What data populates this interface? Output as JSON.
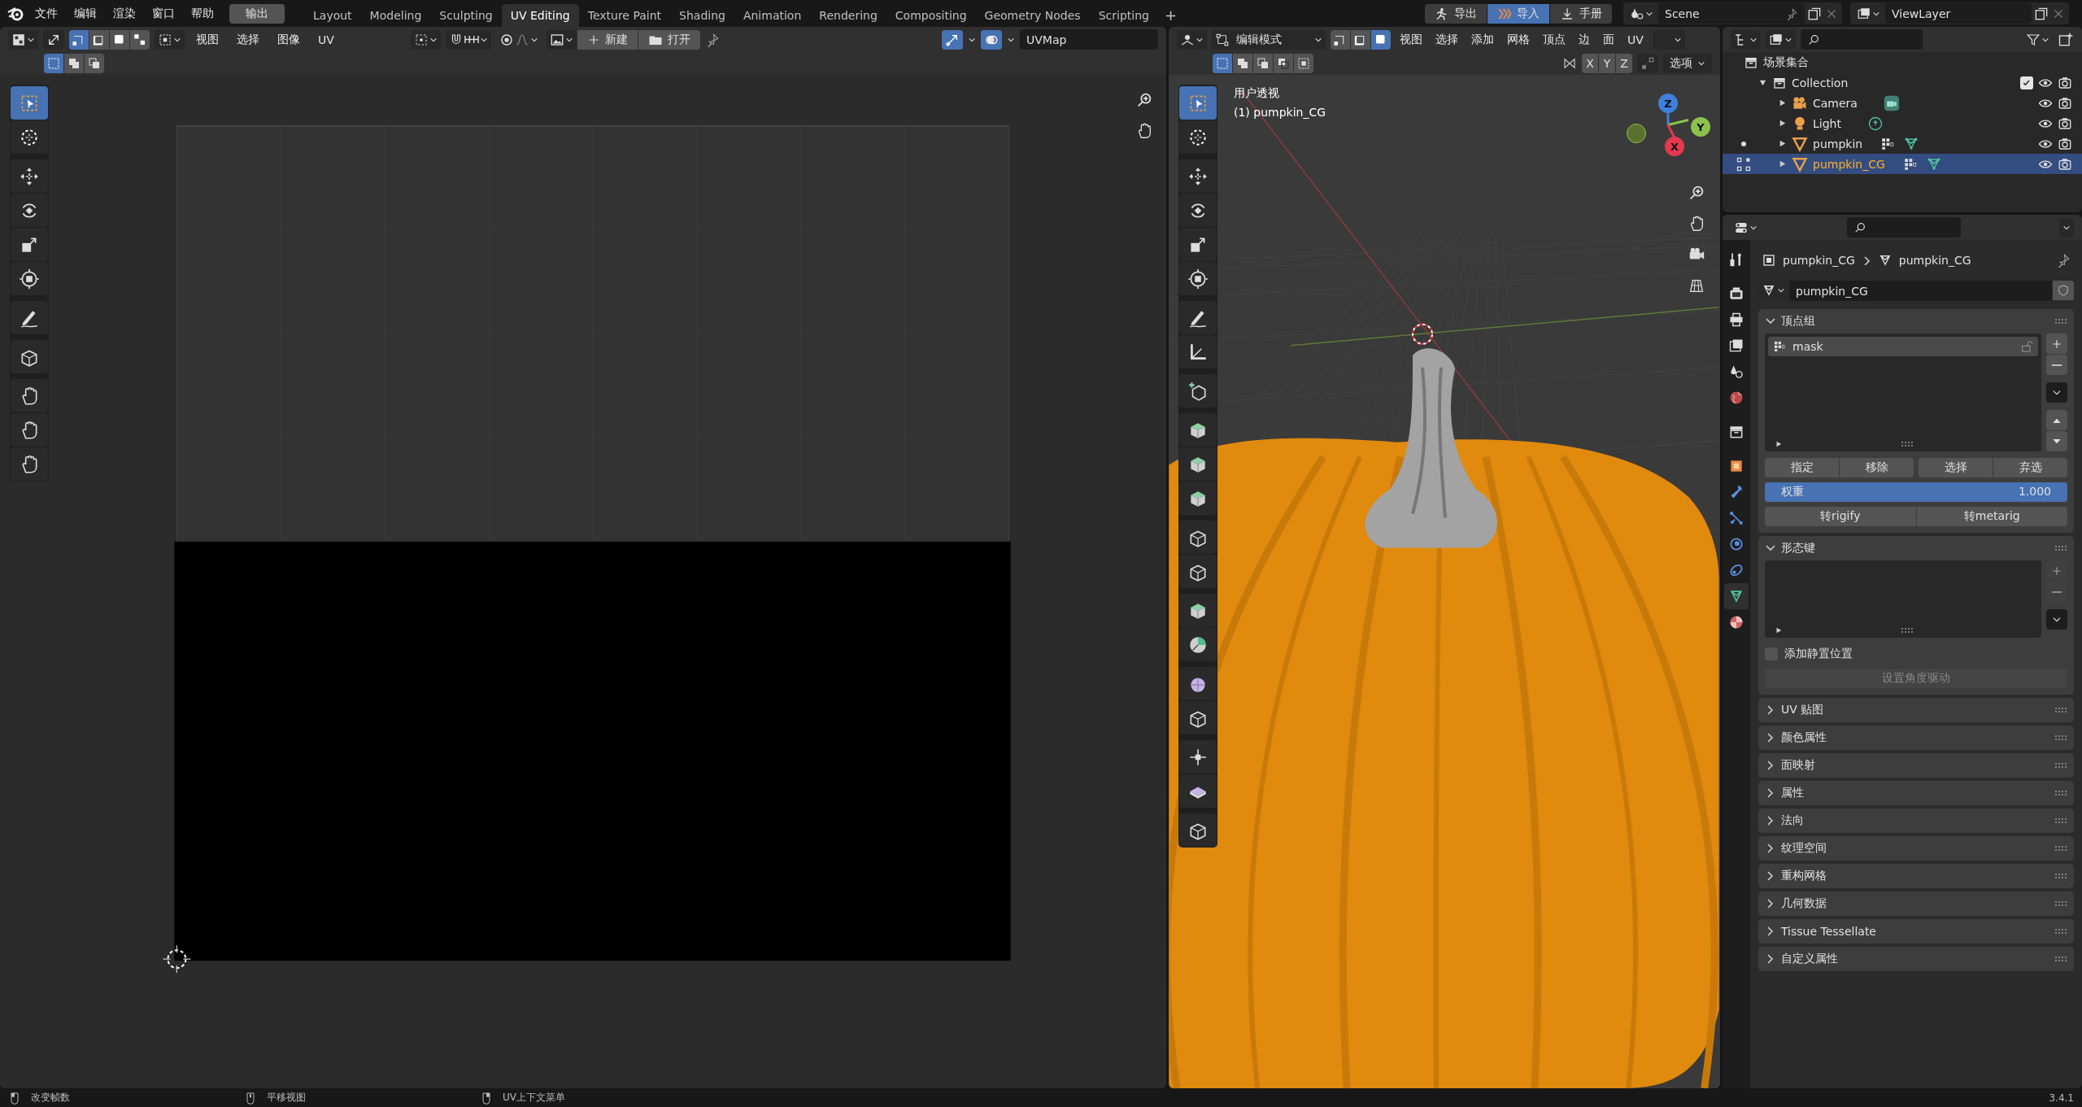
{
  "topbar": {
    "menus": [
      "文件",
      "编辑",
      "渲染",
      "窗口",
      "帮助"
    ],
    "output_button": "输出",
    "workspaces": [
      {
        "label": "Layout",
        "selected": false
      },
      {
        "label": "Modeling",
        "selected": false
      },
      {
        "label": "Sculpting",
        "selected": false
      },
      {
        "label": "UV Editing",
        "selected": true
      },
      {
        "label": "Texture Paint",
        "selected": false
      },
      {
        "label": "Shading",
        "selected": false
      },
      {
        "label": "Animation",
        "selected": false
      },
      {
        "label": "Rendering",
        "selected": false
      },
      {
        "label": "Compositing",
        "selected": false
      },
      {
        "label": "Geometry Nodes",
        "selected": false
      },
      {
        "label": "Scripting",
        "selected": false
      }
    ],
    "add_workspace": "+",
    "addon_buttons": [
      {
        "kind": "export",
        "label": "导出",
        "selected": false
      },
      {
        "kind": "import",
        "label": "导入",
        "selected": true
      },
      {
        "kind": "manual",
        "label": "手册",
        "selected": false
      }
    ],
    "scene": "Scene",
    "view_layer": "ViewLayer"
  },
  "uv_editor": {
    "select_modes": [
      {
        "kind": "vertex",
        "selected": true
      },
      {
        "kind": "edge",
        "selected": false
      },
      {
        "kind": "face",
        "selected": false
      },
      {
        "kind": "island",
        "selected": false
      }
    ],
    "menus": [
      "视图",
      "选择",
      "图像",
      "UV"
    ],
    "new_button": "新建",
    "open_button": "打开",
    "uv_map": "UVMap",
    "box_modes": [
      {
        "selected": true
      },
      {
        "selected": false
      },
      {
        "selected": false
      }
    ],
    "tools": [
      {
        "kind": "select",
        "selected": true
      },
      {
        "kind": "cursor",
        "selected": false
      },
      {
        "kind": "move",
        "selected": false
      },
      {
        "kind": "rotate",
        "selected": false
      },
      {
        "kind": "scale",
        "selected": false
      },
      {
        "kind": "transform",
        "selected": false
      },
      {
        "kind": "annotate",
        "selected": false
      },
      {
        "kind": "rip",
        "selected": false
      },
      {
        "kind": "grab",
        "selected": false
      },
      {
        "kind": "relax",
        "selected": false
      },
      {
        "kind": "pinch",
        "selected": false
      }
    ]
  },
  "viewport": {
    "mode": "编辑模式",
    "select_modes": [
      {
        "kind": "vertex",
        "selected": false
      },
      {
        "kind": "edge",
        "selected": false
      },
      {
        "kind": "face",
        "selected": true
      }
    ],
    "menus": [
      "视图",
      "选择",
      "添加",
      "网格",
      "顶点",
      "边",
      "面",
      "UV"
    ],
    "box_modes": [
      {
        "selected": true
      },
      {
        "selected": false
      },
      {
        "selected": false
      },
      {
        "selected": false
      },
      {
        "selected": false
      }
    ],
    "mirror_axes": [
      {
        "label": "X",
        "selected": false
      },
      {
        "label": "Y",
        "selected": false
      },
      {
        "label": "Z",
        "selected": false
      }
    ],
    "options": "选项",
    "view_name": "用户透视",
    "object_label": "(1) pumpkin_CG",
    "gizmo_axes": [
      "Z",
      "Y",
      "X"
    ],
    "tools": [
      {
        "kind": "select",
        "selected": true
      },
      {
        "kind": "cursor",
        "selected": false
      },
      {
        "kind": "move",
        "selected": false
      },
      {
        "kind": "rotate",
        "selected": false
      },
      {
        "kind": "scale",
        "selected": false
      },
      {
        "kind": "transform",
        "selected": false
      },
      {
        "kind": "annotate",
        "selected": false
      },
      {
        "kind": "measure",
        "selected": false
      },
      {
        "kind": "add_cube",
        "selected": false
      },
      {
        "kind": "extrude",
        "selected": false
      },
      {
        "kind": "inset",
        "selected": false
      },
      {
        "kind": "bevel",
        "selected": false
      },
      {
        "kind": "loop_cut",
        "selected": false
      },
      {
        "kind": "knife",
        "selected": false
      },
      {
        "kind": "poly_build",
        "selected": false
      },
      {
        "kind": "spin",
        "selected": false
      },
      {
        "kind": "smooth",
        "selected": false
      },
      {
        "kind": "edge_slide",
        "selected": false
      },
      {
        "kind": "shrink",
        "selected": false
      },
      {
        "kind": "shear",
        "selected": false
      },
      {
        "kind": "rip",
        "selected": false
      }
    ]
  },
  "outliner": {
    "root": "场景集合",
    "collections": [
      {
        "name": "Collection",
        "expanded": true,
        "checked": true,
        "children": [
          {
            "name": "Camera",
            "kind": "camera",
            "selected": false
          },
          {
            "name": "Light",
            "kind": "light",
            "selected": false
          },
          {
            "name": "pumpkin",
            "kind": "mesh",
            "selected": false,
            "edit_mode": false
          },
          {
            "name": "pumpkin_CG",
            "kind": "mesh",
            "selected": true,
            "edit_mode": true
          }
        ]
      }
    ]
  },
  "properties": {
    "tabs": [
      {
        "kind": "tool",
        "selected": false
      },
      {
        "kind": "render",
        "selected": false
      },
      {
        "kind": "output",
        "selected": false
      },
      {
        "kind": "view_layer",
        "selected": false
      },
      {
        "kind": "scene",
        "selected": false
      },
      {
        "kind": "world",
        "selected": false
      },
      {
        "kind": "collection",
        "selected": false
      },
      {
        "kind": "object",
        "selected": false
      },
      {
        "kind": "modifier",
        "selected": false
      },
      {
        "kind": "particles",
        "selected": false
      },
      {
        "kind": "physics",
        "selected": false
      },
      {
        "kind": "constraints",
        "selected": false
      },
      {
        "kind": "data",
        "selected": true
      },
      {
        "kind": "material",
        "selected": false
      }
    ],
    "breadcrumb": [
      "pumpkin_CG",
      "pumpkin_CG"
    ],
    "mesh_name": "pumpkin_CG",
    "vertex_groups": {
      "title": "顶点组",
      "expanded": true,
      "items": [
        {
          "name": "mask",
          "selected": true
        }
      ],
      "buttons": [
        "指定",
        "移除",
        "选择",
        "弃选"
      ],
      "weight": {
        "label": "权重",
        "value": "1.000",
        "level": 1
      },
      "rig_buttons": [
        "转rigify",
        "转metarig"
      ]
    },
    "shape_keys": {
      "title": "形态键",
      "expanded": true,
      "list_buttons_disabled": true,
      "relative": {
        "label": "添加静置位置",
        "checked": false
      },
      "drive_button": {
        "label": "设置角度驱动",
        "disabled": true
      }
    },
    "panels": [
      {
        "title": "UV 贴图",
        "expanded": false
      },
      {
        "title": "颜色属性",
        "expanded": false
      },
      {
        "title": "面映射",
        "expanded": false
      },
      {
        "title": "属性",
        "expanded": false
      },
      {
        "title": "法向",
        "expanded": false
      },
      {
        "title": "纹理空间",
        "expanded": false
      },
      {
        "title": "重构网格",
        "expanded": false
      },
      {
        "title": "几何数据",
        "expanded": false
      },
      {
        "title": "Tissue Tessellate",
        "expanded": false
      },
      {
        "title": "自定义属性",
        "expanded": false
      }
    ]
  },
  "status_bar": {
    "hints": [
      {
        "kind": "mouse_left",
        "label": "改变帧数"
      },
      {
        "kind": "mouse_middle",
        "label": "平移视图"
      },
      {
        "kind": "mouse_right",
        "label": "UV上下文菜单"
      }
    ],
    "version": "3.4.1"
  }
}
